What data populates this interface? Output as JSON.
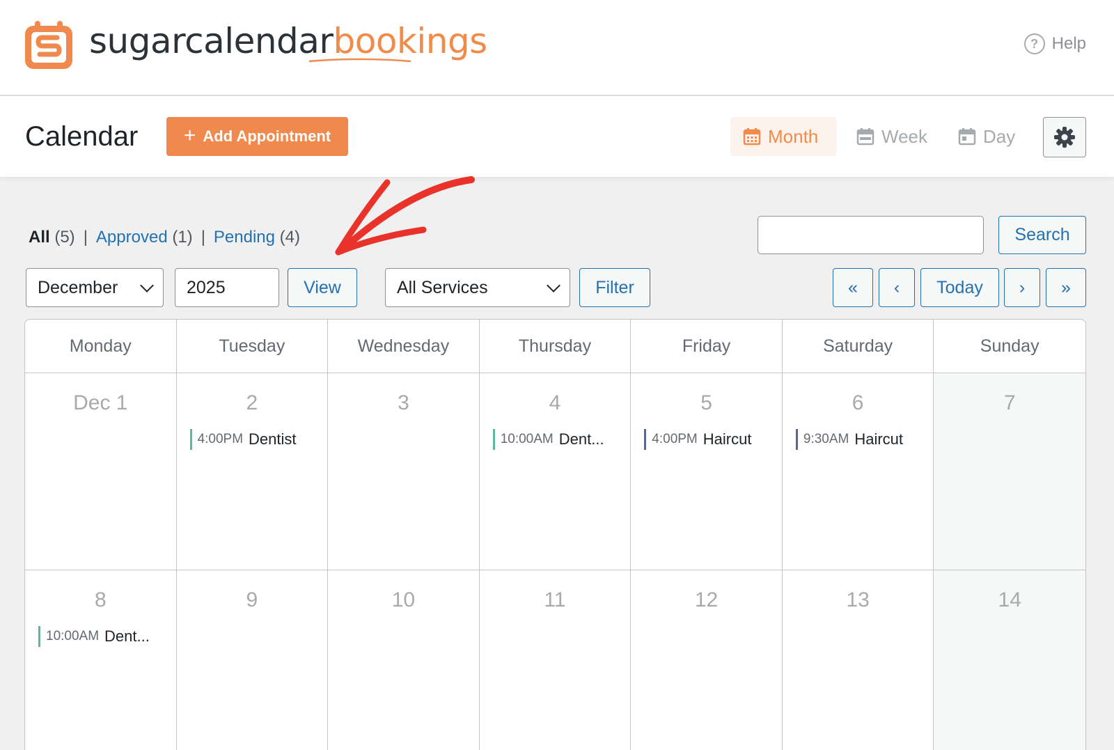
{
  "brand": {
    "part1": "sugarcalendar",
    "part2": "bookings"
  },
  "help_label": "Help",
  "page": {
    "title": "Calendar",
    "add_label": "Add Appointment"
  },
  "view_tabs": {
    "month": "Month",
    "week": "Week",
    "day": "Day",
    "active": "month"
  },
  "status_filters": {
    "all": {
      "label": "All",
      "count": "(5)"
    },
    "approved": {
      "label": "Approved",
      "count": "(1)"
    },
    "pending": {
      "label": "Pending",
      "count": "(4)"
    },
    "separator": "|"
  },
  "search": {
    "value": "",
    "button": "Search"
  },
  "filters": {
    "month": "December",
    "year": "2025",
    "view_button": "View",
    "service": "All Services",
    "filter_button": "Filter"
  },
  "nav": {
    "first": "«",
    "prev": "‹",
    "today": "Today",
    "next": "›",
    "last": "»"
  },
  "weekdays": [
    "Monday",
    "Tuesday",
    "Wednesday",
    "Thursday",
    "Friday",
    "Saturday",
    "Sunday"
  ],
  "weeks": [
    [
      {
        "day": "Dec 1"
      },
      {
        "day": "2",
        "event": {
          "time": "4:00PM",
          "title": "Dentist",
          "color": "#5fb4a2"
        }
      },
      {
        "day": "3"
      },
      {
        "day": "4",
        "event": {
          "time": "10:00AM",
          "title": "Dent...",
          "color": "#5fb4a2"
        }
      },
      {
        "day": "5",
        "event": {
          "time": "4:00PM",
          "title": "Haircut",
          "color": "#4f6b97"
        }
      },
      {
        "day": "6",
        "event": {
          "time": "9:30AM",
          "title": "Haircut",
          "color": "#4f6b97"
        }
      },
      {
        "day": "7"
      }
    ],
    [
      {
        "day": "8",
        "event": {
          "time": "10:00AM",
          "title": "Dent...",
          "color": "#5fb4a2"
        }
      },
      {
        "day": "9"
      },
      {
        "day": "10"
      },
      {
        "day": "11"
      },
      {
        "day": "12"
      },
      {
        "day": "13"
      },
      {
        "day": "14"
      }
    ]
  ],
  "colors": {
    "accent": "#f0894d",
    "link": "#2271b1",
    "annotation": "#e8322a"
  }
}
